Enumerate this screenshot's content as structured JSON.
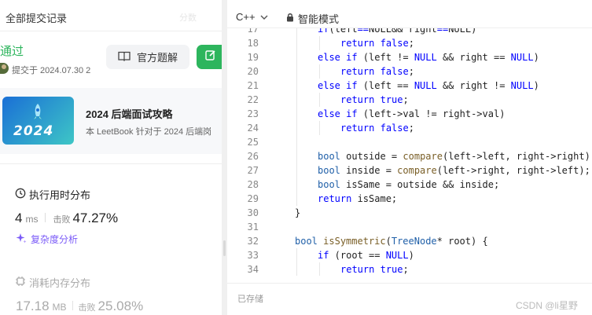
{
  "left": {
    "header_title": "全部提交记录",
    "header_faded": "分数",
    "status": "通过",
    "submitted_at": "提交于 2024.07.30 2",
    "solution_button": "官方题解",
    "book": {
      "cover_year": "2024",
      "title": "2024 后端面试攻略",
      "subtitle": "本 LeetBook 针对于 2024 后端岗"
    },
    "runtime": {
      "title": "执行用时分布",
      "value": "4",
      "unit": "ms",
      "beat_label": "击败",
      "beat_pct": "47.27%",
      "complexity_link": "复杂度分析"
    },
    "memory": {
      "title": "消耗内存分布",
      "value": "17.18",
      "unit": "MB",
      "beat_label": "击败",
      "beat_pct": "25.08%"
    }
  },
  "editor": {
    "language": "C++",
    "mode": "智能模式",
    "saved_status": "已存储",
    "watermark": "CSDN @li星野"
  },
  "colors": {
    "accent_green": "#2db55d",
    "keyword": "#0000ff",
    "type": "#1f5fa8",
    "function": "#795e26",
    "purple": "#7a5af8"
  },
  "icons": [
    "chevron-down-icon",
    "lock-icon",
    "book-icon",
    "edit-icon",
    "clock-icon",
    "sparkle-icon",
    "memory-icon"
  ],
  "code_lines": [
    {
      "n": "17",
      "indent": 1,
      "segs": [
        [
          "kw",
          "if"
        ],
        [
          "",
          "(left"
        ],
        [
          "",
          ""
        ],
        [
          "kw",
          "=="
        ],
        [
          "",
          "NULL"
        ],
        [
          "",
          "&& right"
        ],
        [
          "kw",
          "=="
        ],
        [
          "",
          "NULL)"
        ]
      ]
    },
    {
      "n": "18",
      "indent": 2,
      "segs": [
        [
          "kw",
          "return"
        ],
        [
          "",
          " "
        ],
        [
          "kw",
          "false"
        ],
        [
          "",
          ";"
        ]
      ]
    },
    {
      "n": "19",
      "indent": 1,
      "segs": [
        [
          "kw",
          "else if"
        ],
        [
          "",
          " (left != "
        ],
        [
          "kw",
          "NULL"
        ],
        [
          "",
          " && right == "
        ],
        [
          "kw",
          "NULL"
        ],
        [
          "",
          ")"
        ]
      ]
    },
    {
      "n": "20",
      "indent": 2,
      "segs": [
        [
          "kw",
          "return"
        ],
        [
          "",
          " "
        ],
        [
          "kw",
          "false"
        ],
        [
          "",
          ";"
        ]
      ]
    },
    {
      "n": "21",
      "indent": 1,
      "segs": [
        [
          "kw",
          "else if"
        ],
        [
          "",
          " (left == "
        ],
        [
          "kw",
          "NULL"
        ],
        [
          "",
          " && right != "
        ],
        [
          "kw",
          "NULL"
        ],
        [
          "",
          ")"
        ]
      ]
    },
    {
      "n": "22",
      "indent": 2,
      "segs": [
        [
          "kw",
          "return"
        ],
        [
          "",
          " "
        ],
        [
          "kw",
          "true"
        ],
        [
          "",
          ";"
        ]
      ]
    },
    {
      "n": "23",
      "indent": 1,
      "segs": [
        [
          "kw",
          "else if"
        ],
        [
          "",
          " (left->val != right->val)"
        ]
      ]
    },
    {
      "n": "24",
      "indent": 2,
      "segs": [
        [
          "kw",
          "return"
        ],
        [
          "",
          " "
        ],
        [
          "kw",
          "false"
        ],
        [
          "",
          ";"
        ]
      ]
    },
    {
      "n": "25",
      "indent": 1,
      "segs": []
    },
    {
      "n": "26",
      "indent": 1,
      "segs": [
        [
          "ty",
          "bool"
        ],
        [
          "",
          " outside = "
        ],
        [
          "fn",
          "compare"
        ],
        [
          "",
          "(left->left, right->right);"
        ]
      ]
    },
    {
      "n": "27",
      "indent": 1,
      "segs": [
        [
          "ty",
          "bool"
        ],
        [
          "",
          " inside = "
        ],
        [
          "fn",
          "compare"
        ],
        [
          "",
          "(left->right, right->left);"
        ]
      ]
    },
    {
      "n": "28",
      "indent": 1,
      "segs": [
        [
          "ty",
          "bool"
        ],
        [
          "",
          " isSame = outside && inside;"
        ]
      ]
    },
    {
      "n": "29",
      "indent": 1,
      "segs": [
        [
          "kw",
          "return"
        ],
        [
          "",
          " isSame;"
        ]
      ]
    },
    {
      "n": "30",
      "indent": 0,
      "segs": [
        [
          "",
          "}"
        ]
      ]
    },
    {
      "n": "31",
      "indent": 0,
      "segs": []
    },
    {
      "n": "32",
      "indent": 0,
      "segs": [
        [
          "ty",
          "bool"
        ],
        [
          "",
          " "
        ],
        [
          "fn",
          "isSymmetric"
        ],
        [
          "",
          "("
        ],
        [
          "ty",
          "TreeNode"
        ],
        [
          "",
          "* root) {"
        ]
      ]
    },
    {
      "n": "33",
      "indent": 1,
      "segs": [
        [
          "kw",
          "if"
        ],
        [
          "",
          " (root == "
        ],
        [
          "kw",
          "NULL"
        ],
        [
          "",
          ")"
        ]
      ]
    },
    {
      "n": "34",
      "indent": 2,
      "segs": [
        [
          "kw",
          "return"
        ],
        [
          "",
          " "
        ],
        [
          "kw",
          "true"
        ],
        [
          "",
          ";"
        ]
      ]
    }
  ]
}
